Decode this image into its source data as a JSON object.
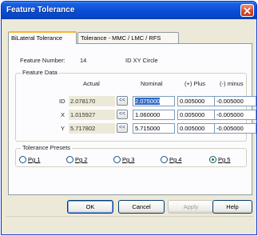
{
  "window": {
    "title": "Feature Tolerance"
  },
  "tabs": [
    {
      "label": "BiLateral Tolerance",
      "active": true
    },
    {
      "label": "Tolerance - MMC / LMC / RFS",
      "active": false
    }
  ],
  "feature": {
    "number_label": "Feature Number:",
    "number_value": "14",
    "name": "ID XY Circle"
  },
  "feature_data": {
    "title": "Feature Data",
    "headers": {
      "actual": "Actual",
      "nominal": "Nominal",
      "plus": "(+) Plus",
      "minus": "(-) minus"
    },
    "copy_label": "<<",
    "rows": [
      {
        "label": "ID",
        "actual": "2.078170",
        "nominal": "2.075000",
        "plus": "0.005000",
        "minus": "-0.005000"
      },
      {
        "label": "X",
        "actual": "1.015927",
        "nominal": "1.060000",
        "plus": "0.005000",
        "minus": "-0.005000"
      },
      {
        "label": "Y",
        "actual": "5.717802",
        "nominal": "5.715000",
        "plus": "0.005000",
        "minus": "-0.005000"
      }
    ]
  },
  "presets": {
    "title": "Tolerance Presets",
    "options": [
      "Pg 1",
      "Pg 2",
      "Pg 3",
      "Pg 4",
      "Pg 5"
    ],
    "selected": "Pg 5"
  },
  "buttons": {
    "ok": "OK",
    "cancel": "Cancel",
    "apply": "Apply",
    "help": "Help"
  },
  "colors": {
    "titlebar": "#0a4fd8",
    "dialog": "#ece9d8",
    "selection": "#316ac5",
    "close": "#d8472a"
  }
}
